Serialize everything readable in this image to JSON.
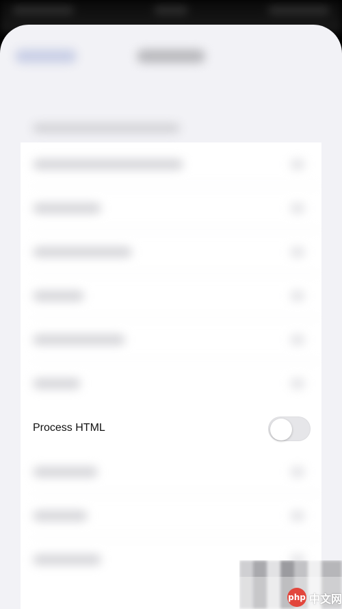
{
  "nav": {
    "back_label": "",
    "title": ""
  },
  "section": {
    "header": ""
  },
  "rows": [
    {
      "label": "",
      "kind": "disclosure"
    },
    {
      "label": "",
      "kind": "disclosure"
    },
    {
      "label": "",
      "kind": "disclosure"
    },
    {
      "label": "",
      "kind": "disclosure"
    },
    {
      "label": "",
      "kind": "disclosure"
    },
    {
      "label": "",
      "kind": "disclosure"
    },
    {
      "label": "Process HTML",
      "kind": "toggle",
      "toggle_on": false
    },
    {
      "label": "",
      "kind": "disclosure"
    },
    {
      "label": "",
      "kind": "disclosure"
    },
    {
      "label": "",
      "kind": "disclosure"
    }
  ],
  "watermark": {
    "logo_text": "php",
    "site_text": "中文网"
  },
  "colors": {
    "background": "#f2f2f6",
    "cell": "#ffffff",
    "toggle_off": "#e6e6e9",
    "watermark_logo": "#e2463c"
  }
}
